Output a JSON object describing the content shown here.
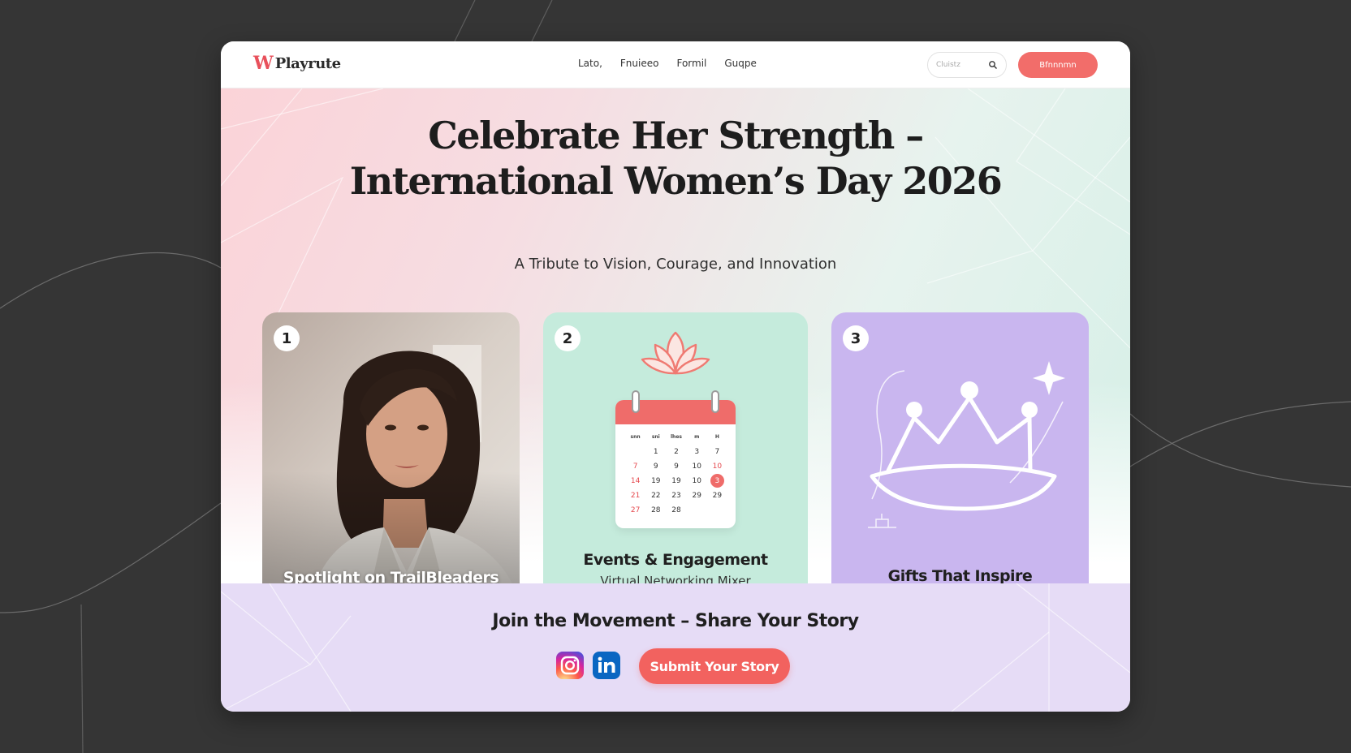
{
  "nav": {
    "logo_mark": "W",
    "logo_text": "Playrute",
    "links": [
      "Lato,",
      "Fnuieeo",
      "Formil",
      "Guqpe"
    ],
    "search_placeholder": "Cluistz",
    "cta_label": "Bfnnnmn"
  },
  "hero": {
    "title_line1": "Celebrate Her Strength –",
    "title_line2": "International Women’s Day 2026",
    "subtitle": "A Tribute to Vision, Courage, and Innovation"
  },
  "cards": [
    {
      "number": "1",
      "caption": "Spotlight on TrailBleaders"
    },
    {
      "number": "2",
      "caption": "Events & Engagement",
      "subcaption": "Virtual Networking Mixer"
    },
    {
      "number": "3",
      "caption": "Gifts That Inspire"
    }
  ],
  "calendar": {
    "weekday_labels": [
      "snn",
      "sni",
      "lhes",
      "m",
      "H"
    ],
    "rows": [
      [
        "",
        "1",
        "2",
        "3",
        "7"
      ],
      [
        "7",
        "9",
        "9",
        "10",
        "10"
      ],
      [
        "14",
        "19",
        "19",
        "10",
        "3"
      ],
      [
        "21",
        "22",
        "23",
        "29",
        "29"
      ],
      [
        "27",
        "28",
        "28",
        "",
        ""
      ]
    ],
    "highlight_day": "3",
    "accent": "#ef6c6a"
  },
  "footer": {
    "title": "Join the Movement – Share Your Story",
    "submit_label": "Submit Your Story",
    "social_icons": [
      "instagram-icon",
      "linkedin-icon"
    ]
  },
  "colors": {
    "accent": "#f26d6a",
    "mint": "#c5ebdc",
    "lavender": "#c9b6ef",
    "band": "#e6dcf6"
  }
}
